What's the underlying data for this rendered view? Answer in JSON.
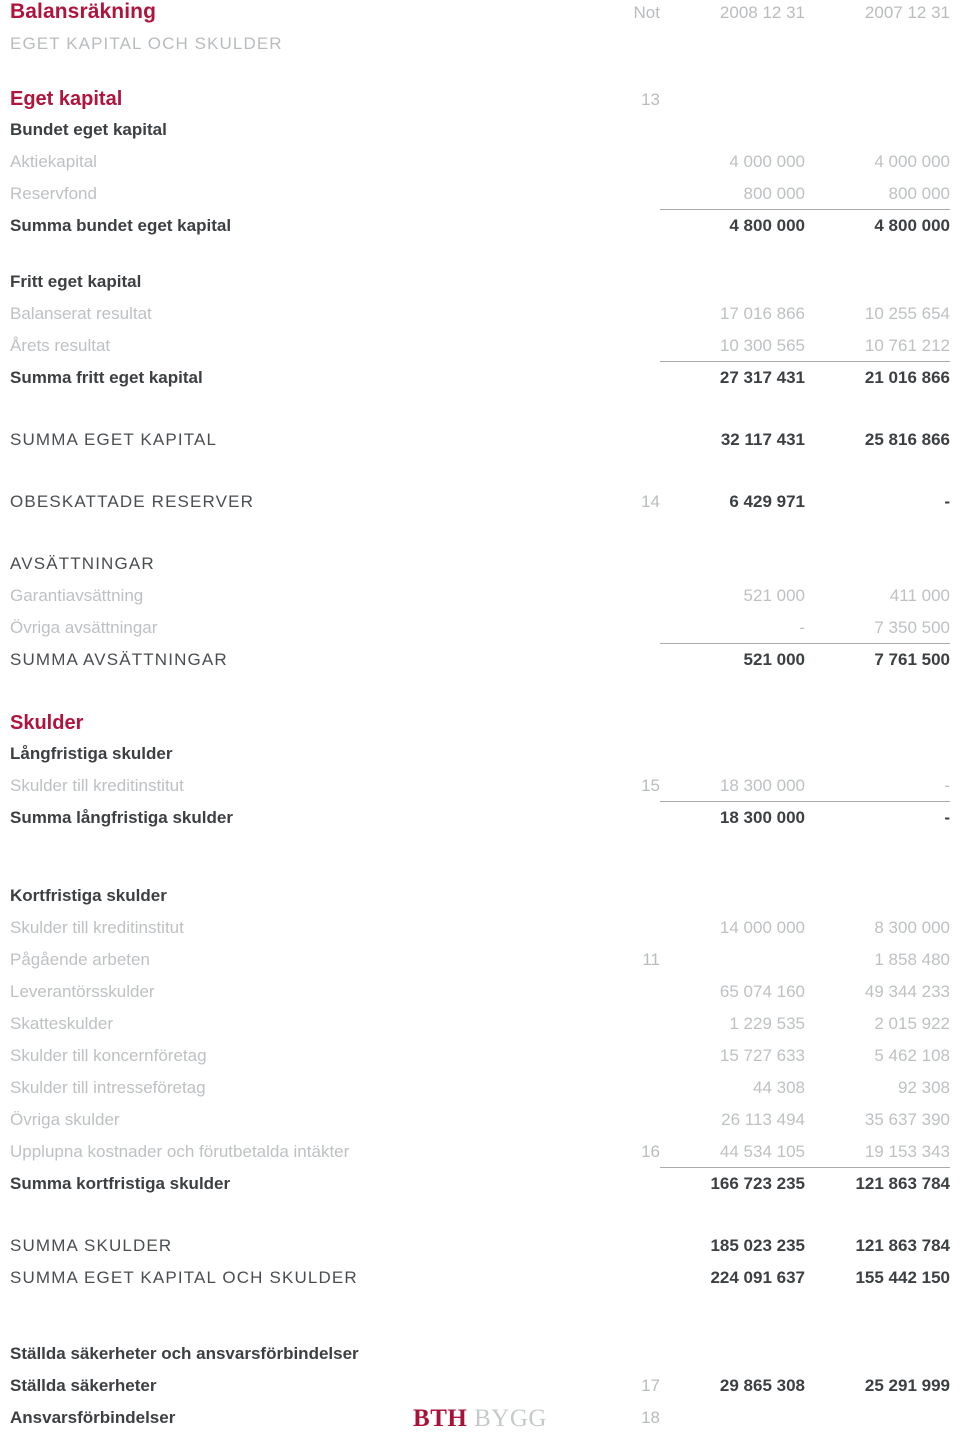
{
  "document": {
    "title": "Balansräkning",
    "subtitle": "EGET KAPITAL OCH SKULDER",
    "note_header": "Not",
    "col1_header": "2008 12 31",
    "col2_header": "2007 12 31",
    "accent_color": "#b0143c",
    "muted_color": "#bec1c3",
    "dark_color": "#3c4043"
  },
  "logo": {
    "part1": "BTH",
    "part2": "BYGG"
  },
  "sections": {
    "equity": {
      "heading": "Eget kapital",
      "heading_note": "13",
      "restricted_heading": "Bundet eget kapital",
      "rows": [
        {
          "label": "Aktiekapital",
          "note": "",
          "v1": "4 000 000",
          "v2": "4 000 000"
        },
        {
          "label": "Reservfond",
          "note": "",
          "v1": "800 000",
          "v2": "800 000"
        },
        {
          "label": "Summa bundet eget kapital",
          "note": "",
          "v1": "4 800 000",
          "v2": "4 800 000"
        }
      ],
      "free_heading": "Fritt eget kapital",
      "free_rows": [
        {
          "label": "Balanserat resultat",
          "note": "",
          "v1": "17 016 866",
          "v2": "10 255 654"
        },
        {
          "label": "Årets resultat",
          "note": "",
          "v1": "10 300 565",
          "v2": "10 761 212"
        },
        {
          "label": "Summa fritt eget kapital",
          "note": "",
          "v1": "27 317 431",
          "v2": "21 016 866"
        }
      ],
      "total": {
        "label": "SUMMA EGET KAPITAL",
        "note": "",
        "v1": "32 117 431",
        "v2": "25 816 866"
      }
    },
    "untaxed_reserves": {
      "label": "OBESKATTADE RESERVER",
      "note": "14",
      "v1": "6 429 971",
      "v2": "-"
    },
    "provisions": {
      "heading": "AVSÄTTNINGAR",
      "rows": [
        {
          "label": "Garantiavsättning",
          "note": "",
          "v1": "521 000",
          "v2": "411 000"
        },
        {
          "label": "Övriga avsättningar",
          "note": "",
          "v1": "-",
          "v2": "7 350 500"
        }
      ],
      "total": {
        "label": "SUMMA AVSÄTTNINGAR",
        "note": "",
        "v1": "521 000",
        "v2": "7 761 500"
      }
    },
    "liabilities": {
      "heading": "Skulder",
      "long_term_heading": "Långfristiga skulder",
      "long_term_rows": [
        {
          "label": "Skulder till kreditinstitut",
          "note": "15",
          "v1": "18 300 000",
          "v2": "-"
        }
      ],
      "long_term_total": {
        "label": "Summa långfristiga skulder",
        "note": "",
        "v1": "18 300 000",
        "v2": "-"
      },
      "short_term_heading": "Kortfristiga skulder",
      "short_term_rows": [
        {
          "label": "Skulder till kreditinstitut",
          "note": "",
          "v1": "14 000 000",
          "v2": "8 300 000"
        },
        {
          "label": "Pågående arbeten",
          "note": "11",
          "v1": "",
          "v2": "1 858 480"
        },
        {
          "label": "Leverantörsskulder",
          "note": "",
          "v1": "65 074 160",
          "v2": "49 344 233"
        },
        {
          "label": "Skatteskulder",
          "note": "",
          "v1": "1 229 535",
          "v2": "2 015 922"
        },
        {
          "label": "Skulder till koncernföretag",
          "note": "",
          "v1": "15 727 633",
          "v2": "5 462 108"
        },
        {
          "label": "Skulder till intresseföretag",
          "note": "",
          "v1": "44 308",
          "v2": "92 308"
        },
        {
          "label": "Övriga skulder",
          "note": "",
          "v1": "26 113 494",
          "v2": "35 637 390"
        },
        {
          "label": "Upplupna kostnader och förutbetalda intäkter",
          "note": "16",
          "v1": "44 534 105",
          "v2": "19 153 343"
        }
      ],
      "short_term_total": {
        "label": "Summa kortfristiga skulder",
        "note": "",
        "v1": "166 723 235",
        "v2": "121 863 784"
      }
    },
    "grand_totals": [
      {
        "label": "SUMMA SKULDER",
        "note": "",
        "v1": "185 023 235",
        "v2": "121 863 784"
      },
      {
        "label": "SUMMA EGET KAPITAL OCH SKULDER",
        "note": "",
        "v1": "224 091 637",
        "v2": "155 442 150"
      }
    ],
    "pledges": {
      "heading": "Ställda säkerheter och ansvarsförbindelser",
      "rows": [
        {
          "label": "Ställda säkerheter",
          "note": "17",
          "v1": "29 865 308",
          "v2": "25 291 999"
        },
        {
          "label": "Ansvarsförbindelser",
          "note": "18",
          "v1": "",
          "v2": ""
        }
      ]
    }
  }
}
